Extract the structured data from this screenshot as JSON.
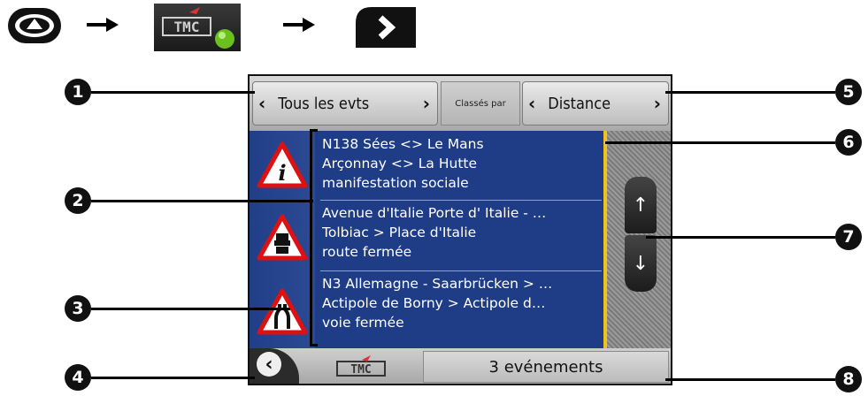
{
  "flow": {
    "tmc_logo_text": "TMC",
    "steps": [
      "main-menu-icon",
      "tmc-icon",
      "next-button-icon"
    ]
  },
  "screen": {
    "topbar": {
      "filter_label": "Tous les evts",
      "sorted_by_label": "Classés par",
      "sort_label": "Distance"
    },
    "events": [
      {
        "icon": "information-warning-icon",
        "lines": [
          "N138 Sées <> Le Mans",
          "Arçonnay <> La Hutte",
          "manifestation sociale"
        ]
      },
      {
        "icon": "traffic-jam-warning-icon",
        "lines": [
          "Avenue d'Italie Porte d' Italie - …",
          "Tolbiac > Place d'Italie",
          "route fermée"
        ]
      },
      {
        "icon": "road-narrows-warning-icon",
        "lines": [
          "N3 Allemagne - Saarbrücken > …",
          "Actipole de Borny > Actipole d…",
          "voie fermée"
        ]
      }
    ],
    "bottombar": {
      "tmc_logo_text": "TMC",
      "count_label": "3 evénements"
    }
  },
  "callouts": [
    "1",
    "2",
    "3",
    "4",
    "5",
    "6",
    "7",
    "8"
  ],
  "colors": {
    "list_background": "#1f3d86",
    "scroll_indicator": "#f2c21a",
    "status_dot": "#6cc01e"
  }
}
